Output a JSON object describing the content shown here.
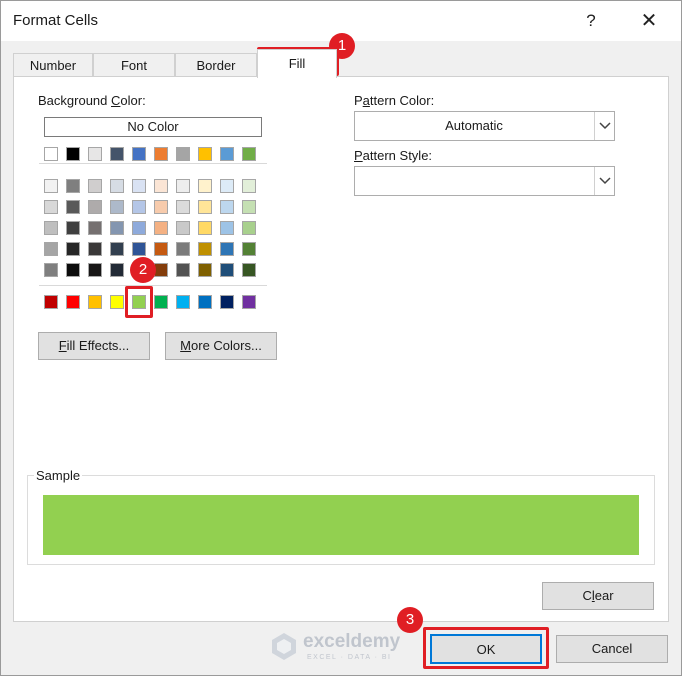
{
  "window": {
    "title": "Format Cells",
    "help": "?",
    "close": "✕"
  },
  "tabs": [
    {
      "label": "Number",
      "active": false
    },
    {
      "label": "Font",
      "active": false
    },
    {
      "label": "Border",
      "active": false
    },
    {
      "label": "Fill",
      "active": true
    }
  ],
  "fill": {
    "background_color_label_pre": "Background ",
    "background_color_label_key": "C",
    "background_color_label_post": "olor:",
    "no_color": "No Color",
    "theme_top_row": [
      "#ffffff",
      "#000000",
      "#e7e6e6",
      "#44546a",
      "#4472c4",
      "#ed7d31",
      "#a5a5a5",
      "#ffc000",
      "#5b9bd5",
      "#70ad47"
    ],
    "theme_shades": [
      [
        "#f2f2f2",
        "#7f7f7f",
        "#d0cece",
        "#d6dce4",
        "#d9e2f3",
        "#fbe5d5",
        "#ededed",
        "#fff2cc",
        "#ddebf7",
        "#e2efd9"
      ],
      [
        "#d8d8d8",
        "#595959",
        "#aeabab",
        "#adb9ca",
        "#b4c6e7",
        "#f7cbac",
        "#dbdbdb",
        "#ffe598",
        "#bdd7ee",
        "#c5e0b3"
      ],
      [
        "#bfbfbf",
        "#3f3f3f",
        "#757070",
        "#8496b0",
        "#8eaadb",
        "#f4b183",
        "#c9c9c9",
        "#ffd965",
        "#9dc3e6",
        "#a8d08d"
      ],
      [
        "#a5a5a5",
        "#262626",
        "#3a3838",
        "#323f4f",
        "#2f5496",
        "#c55a11",
        "#7b7b7b",
        "#bf9000",
        "#2e75b5",
        "#538135"
      ],
      [
        "#7f7f7f",
        "#0c0c0c",
        "#171616",
        "#222a35",
        "#1f3864",
        "#833c0b",
        "#525252",
        "#7f6000",
        "#1f4e79",
        "#375623"
      ]
    ],
    "standard_colors": [
      "#c00000",
      "#ff0000",
      "#ffc000",
      "#ffff00",
      "#92d050",
      "#00b050",
      "#00b0f0",
      "#0070c0",
      "#002060",
      "#7030a0"
    ],
    "selected_color": "#92d050",
    "fill_effects_key": "F",
    "fill_effects_rest": "ill Effects...",
    "more_colors_key": "M",
    "more_colors_rest": "ore Colors...",
    "pattern_color_pre": "P",
    "pattern_color_key": "a",
    "pattern_color_post": "ttern Color:",
    "pattern_color_value": "Automatic",
    "pattern_style_key": "P",
    "pattern_style_post": "attern Style:",
    "pattern_style_value": "",
    "sample_label": "Sample",
    "clear_pre": "C",
    "clear_key": "l",
    "clear_post": "ear"
  },
  "footer": {
    "ok": "OK",
    "cancel": "Cancel"
  },
  "annotations": {
    "step1": "1",
    "step2": "2",
    "step3": "3",
    "color": "#e01e24"
  },
  "watermark": {
    "name": "exceldemy",
    "tagline": "EXCEL · DATA · BI"
  }
}
